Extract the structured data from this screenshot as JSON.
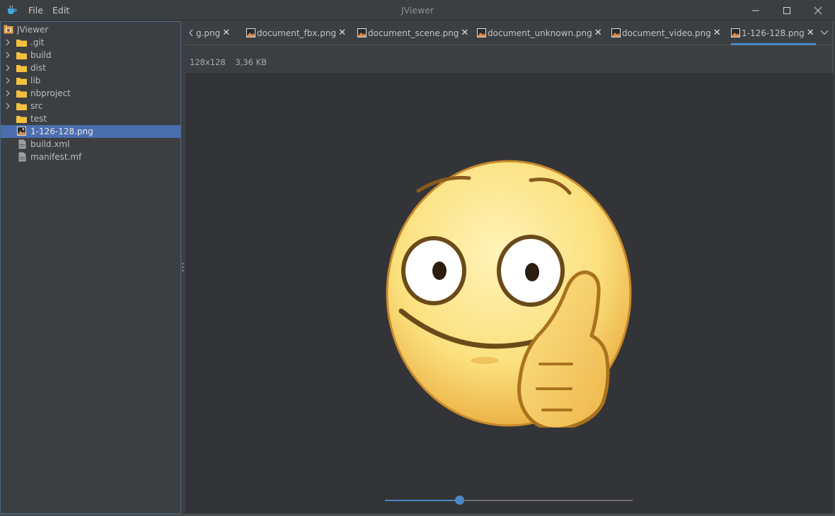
{
  "window": {
    "title": "JViewer"
  },
  "menu": {
    "file": "File",
    "edit": "Edit"
  },
  "sidebar": {
    "root": "JViewer",
    "items": [
      {
        "label": ".git",
        "type": "folder",
        "expandable": true
      },
      {
        "label": "build",
        "type": "folder",
        "expandable": true
      },
      {
        "label": "dist",
        "type": "folder",
        "expandable": true
      },
      {
        "label": "lib",
        "type": "folder",
        "expandable": true
      },
      {
        "label": "nbproject",
        "type": "folder",
        "expandable": true
      },
      {
        "label": "src",
        "type": "folder",
        "expandable": true
      },
      {
        "label": "test",
        "type": "folder",
        "expandable": false
      },
      {
        "label": "1-126-128.png",
        "type": "image",
        "selected": true
      },
      {
        "label": "build.xml",
        "type": "file"
      },
      {
        "label": "manifest.mf",
        "type": "file"
      }
    ]
  },
  "tabs": [
    {
      "label": "g.png"
    },
    {
      "label": "document_fbx.png"
    },
    {
      "label": "document_scene.png"
    },
    {
      "label": "document_unknown.png"
    },
    {
      "label": "document_video.png"
    },
    {
      "label": "1-126-128.png",
      "active": true
    }
  ],
  "image_info": {
    "dimensions": "128x128",
    "size": "3,36 KB"
  },
  "zoom_slider": {
    "value": 0.3
  },
  "colors": {
    "accent": "#4a88c7",
    "selection": "#4b6eaf",
    "folder": "#f3c03f"
  }
}
